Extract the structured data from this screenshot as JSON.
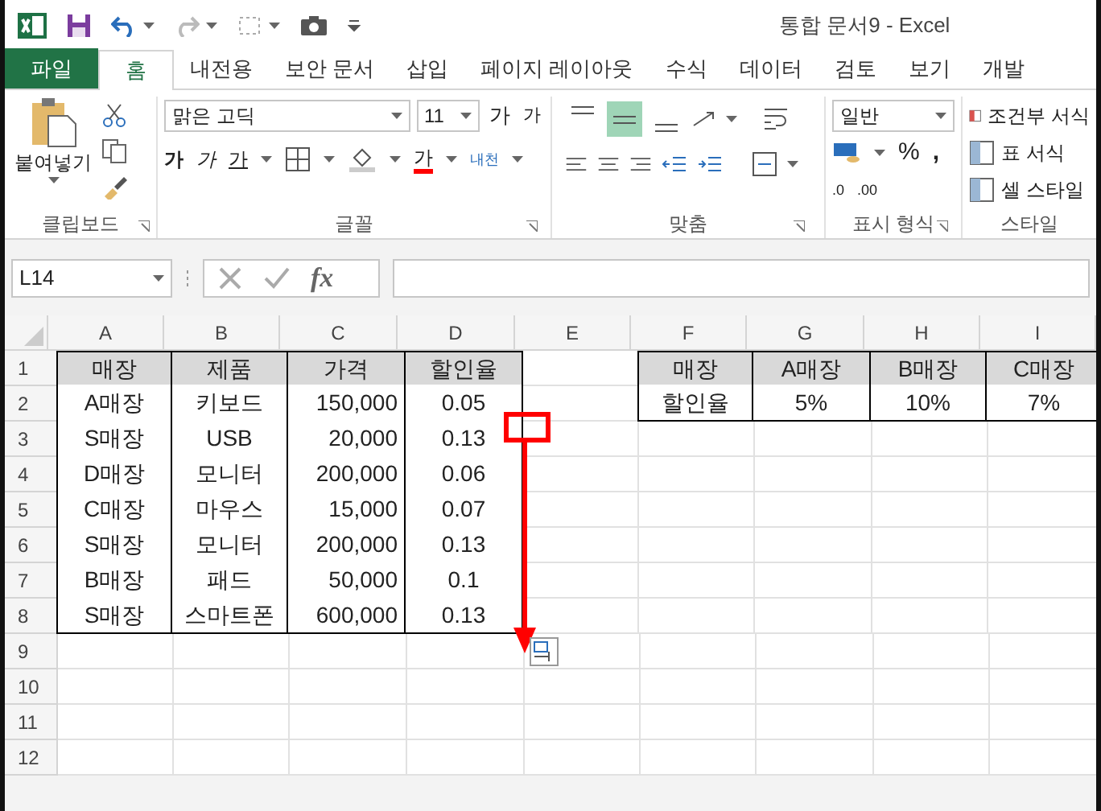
{
  "window": {
    "title": "통합 문서9 - Excel"
  },
  "tabs": [
    {
      "label": "파일",
      "kind": "file",
      "selected": false
    },
    {
      "label": "홈",
      "kind": "tab",
      "selected": true
    },
    {
      "label": "내전용",
      "kind": "tab",
      "selected": false
    },
    {
      "label": "보안 문서",
      "kind": "tab",
      "selected": false
    },
    {
      "label": "삽입",
      "kind": "tab",
      "selected": false
    },
    {
      "label": "페이지 레이아웃",
      "kind": "tab",
      "selected": false
    },
    {
      "label": "수식",
      "kind": "tab",
      "selected": false
    },
    {
      "label": "데이터",
      "kind": "tab",
      "selected": false
    },
    {
      "label": "검토",
      "kind": "tab",
      "selected": false
    },
    {
      "label": "보기",
      "kind": "tab",
      "selected": false
    },
    {
      "label": "개발",
      "kind": "tab",
      "selected": false
    }
  ],
  "ribbon": {
    "clipboard": {
      "paste": "붙여넣기",
      "label": "클립보드"
    },
    "font": {
      "name": "맑은 고딕",
      "size": "11",
      "grow": "가",
      "shrink": "가",
      "bold": "가",
      "italic": "가",
      "underline": "가",
      "font_color": "가",
      "wrap": "내천",
      "label": "글꼴"
    },
    "alignment": {
      "top_row": [
        {
          "kind": "top",
          "selected": false
        },
        {
          "kind": "middle",
          "selected": true
        },
        {
          "kind": "bottom",
          "selected": false
        }
      ],
      "label": "맞춤"
    },
    "number": {
      "format": "일반",
      "percent": "%",
      "comma": ",",
      "increase_decimal": ".0",
      "decrease_decimal": ".00",
      "label": "표시 형식"
    },
    "styles": {
      "items": [
        "조건부 서식",
        "표 서식",
        "셀 스타일"
      ],
      "label": "스타일"
    }
  },
  "formula_bar": {
    "name_box": "L14",
    "fx": "fx"
  },
  "sheet": {
    "columns": [
      "A",
      "B",
      "C",
      "D",
      "E",
      "F",
      "G",
      "H",
      "I"
    ],
    "rows": [
      {
        "header": "1",
        "kind": "header",
        "cells": [
          "매장",
          "제품",
          "가격",
          "할인율",
          "",
          "매장",
          "A매장",
          "B매장",
          "C매장"
        ]
      },
      {
        "header": "2",
        "kind": "data",
        "cells": [
          "A매장",
          "키보드",
          "150,000",
          "0.05",
          "",
          "할인율",
          "5%",
          "10%",
          "7%"
        ]
      },
      {
        "header": "3",
        "kind": "data",
        "cells": [
          "S매장",
          "USB",
          "20,000",
          "0.13"
        ]
      },
      {
        "header": "4",
        "kind": "data",
        "cells": [
          "D매장",
          "모니터",
          "200,000",
          "0.06"
        ]
      },
      {
        "header": "5",
        "kind": "data",
        "cells": [
          "C매장",
          "마우스",
          "15,000",
          "0.07"
        ]
      },
      {
        "header": "6",
        "kind": "data",
        "cells": [
          "S매장",
          "모니터",
          "200,000",
          "0.13"
        ]
      },
      {
        "header": "7",
        "kind": "data",
        "cells": [
          "B매장",
          "패드",
          "50,000",
          "0.1"
        ]
      },
      {
        "header": "8",
        "kind": "data",
        "cells": [
          "S매장",
          "스마트폰",
          "600,000",
          "0.13"
        ]
      },
      {
        "header": "9",
        "cells": []
      },
      {
        "header": "10",
        "cells": []
      },
      {
        "header": "11",
        "cells": []
      },
      {
        "header": "12",
        "cells": []
      }
    ]
  }
}
